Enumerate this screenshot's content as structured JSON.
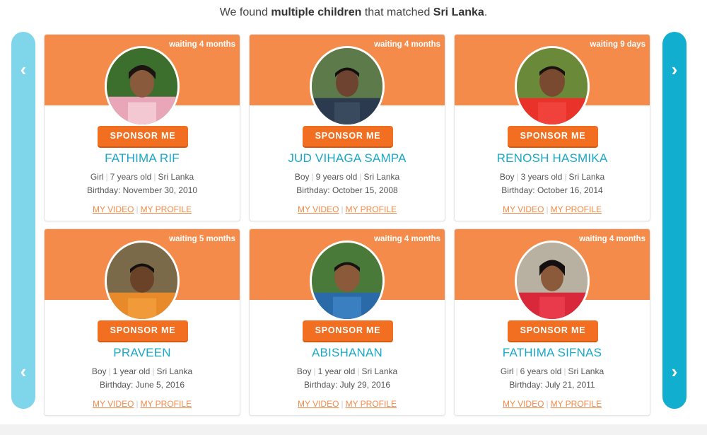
{
  "heading": {
    "prefix": "We found ",
    "emphasis": "multiple children",
    "middle": " that matched ",
    "country": "Sri Lanka",
    "suffix": "."
  },
  "nav": {
    "prev_icon": "chevron-left-icon",
    "next_icon": "chevron-right-icon",
    "prev_glyph": "‹",
    "next_glyph": "›"
  },
  "colors": {
    "band": "#f58b4b",
    "button": "#f26f21",
    "name": "#1aa7c8",
    "nav_left": "#7fd6ea",
    "nav_right": "#12aed0"
  },
  "children": [
    {
      "waiting": "waiting 4 months",
      "sponsor_label": "SPONSOR ME",
      "name": "FATHIMA RIF",
      "gender": "Girl",
      "age": "7 years old",
      "country": "Sri Lanka",
      "birthday": "Birthday: November 30, 2010",
      "video_label": "MY VIDEO",
      "profile_label": "MY PROFILE"
    },
    {
      "waiting": "waiting 4 months",
      "sponsor_label": "SPONSOR ME",
      "name": "JUD VIHAGA SAMPA",
      "gender": "Boy",
      "age": "9 years old",
      "country": "Sri Lanka",
      "birthday": "Birthday: October 15, 2008",
      "video_label": "MY VIDEO",
      "profile_label": "MY PROFILE"
    },
    {
      "waiting": "waiting 9 days",
      "sponsor_label": "SPONSOR ME",
      "name": "RENOSH HASMIKA",
      "gender": "Boy",
      "age": "3 years old",
      "country": "Sri Lanka",
      "birthday": "Birthday: October 16, 2014",
      "video_label": "MY VIDEO",
      "profile_label": "MY PROFILE"
    },
    {
      "waiting": "waiting 5 months",
      "sponsor_label": "SPONSOR ME",
      "name": "PRAVEEN",
      "gender": "Boy",
      "age": "1 year old",
      "country": "Sri Lanka",
      "birthday": "Birthday: June 5, 2016",
      "video_label": "MY VIDEO",
      "profile_label": "MY PROFILE"
    },
    {
      "waiting": "waiting 4 months",
      "sponsor_label": "SPONSOR ME",
      "name": "ABISHANAN",
      "gender": "Boy",
      "age": "1 year old",
      "country": "Sri Lanka",
      "birthday": "Birthday: July 29, 2016",
      "video_label": "MY VIDEO",
      "profile_label": "MY PROFILE"
    },
    {
      "waiting": "waiting 4 months",
      "sponsor_label": "SPONSOR ME",
      "name": "FATHIMA SIFNAS",
      "gender": "Girl",
      "age": "6 years old",
      "country": "Sri Lanka",
      "birthday": "Birthday: July 21, 2011",
      "video_label": "MY VIDEO",
      "profile_label": "MY PROFILE"
    }
  ]
}
